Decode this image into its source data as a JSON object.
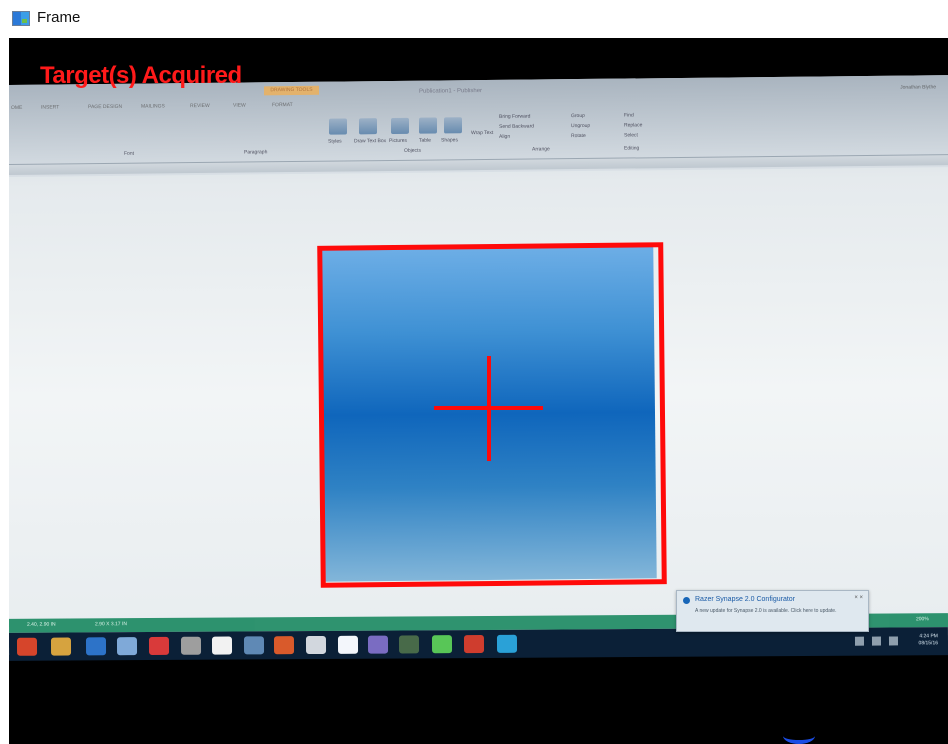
{
  "window": {
    "title": "Frame"
  },
  "overlay": {
    "status": "Target(s) Acquired"
  },
  "ribbon": {
    "contextual_tab": "DRAWING TOOLS",
    "document_title": "Publication1 - Publisher",
    "user": "Jonathan Blythe",
    "tabs": [
      "ome",
      "INSERT",
      "PAGE DESIGN",
      "MAILINGS",
      "REVIEW",
      "VIEW",
      "FORMAT"
    ],
    "tools": [
      "Styles",
      "Draw Text Box",
      "Pictures",
      "Table",
      "Shapes",
      "Wrap Text",
      "Bring Forward",
      "Send Backward",
      "Align",
      "Group",
      "Ungroup",
      "Rotate",
      "Find",
      "Replace",
      "Select"
    ],
    "group_labels": [
      "Font",
      "Paragraph",
      "Objects",
      "Arrange",
      "Editing"
    ]
  },
  "status": [
    "2.40, 2.90 IN",
    "2.90 X 3.17 IN",
    "200%"
  ],
  "notification": {
    "title": "Razer Synapse 2.0 Configurator",
    "body": "A new update for Synapse 2.0 is available. Click here to update."
  },
  "clock": {
    "time": "4:24 PM",
    "date": "08/15/16"
  },
  "colors": {
    "target": "#ff0a0a",
    "shape_top": "#6daee6",
    "shape_mid": "#0f66bc",
    "taskbar": "#0b2037",
    "statusbar": "#1e8b64"
  }
}
